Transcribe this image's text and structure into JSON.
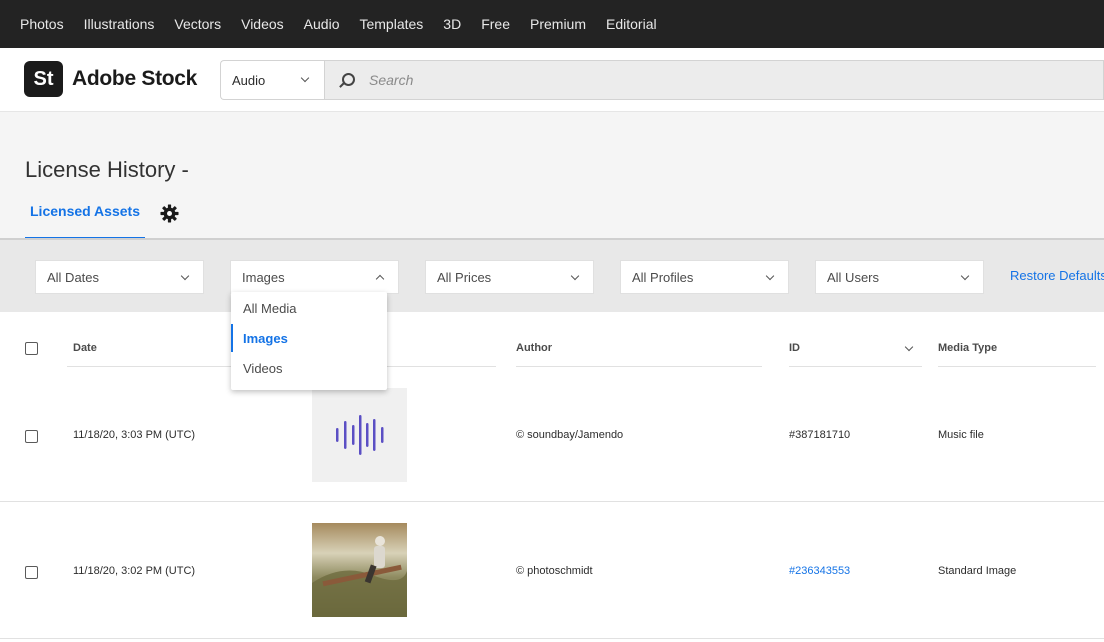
{
  "top_nav": [
    "Photos",
    "Illustrations",
    "Vectors",
    "Videos",
    "Audio",
    "Templates",
    "3D",
    "Free",
    "Premium",
    "Editorial"
  ],
  "header": {
    "logo_mark": "St",
    "logo_text": "Adobe Stock",
    "scope_value": "Audio",
    "search_placeholder": "Search"
  },
  "page": {
    "title": "License History -",
    "tab_label": "Licensed Assets"
  },
  "filters": {
    "dates": "All Dates",
    "media": "Images",
    "prices": "All Prices",
    "profiles": "All Profiles",
    "users": "All Users",
    "restore": "Restore Defaults"
  },
  "media_dropdown": {
    "options": [
      "All Media",
      "Images",
      "Videos"
    ],
    "selected": "Images"
  },
  "table": {
    "headers": {
      "date": "Date",
      "author": "Author",
      "id": "ID",
      "media_type": "Media Type"
    },
    "rows": [
      {
        "date": "11/18/20, 3:03 PM (UTC)",
        "author": "© soundbay/Jamendo",
        "id": "#387181710",
        "media_type": "Music file"
      },
      {
        "date": "11/18/20, 3:02 PM (UTC)",
        "author": "© photoschmidt",
        "id": "#236343553",
        "media_type": "Standard Image"
      }
    ]
  },
  "colors": {
    "accent": "#1473e6",
    "topbar": "#232323",
    "waveform": "#5b4fc4"
  }
}
